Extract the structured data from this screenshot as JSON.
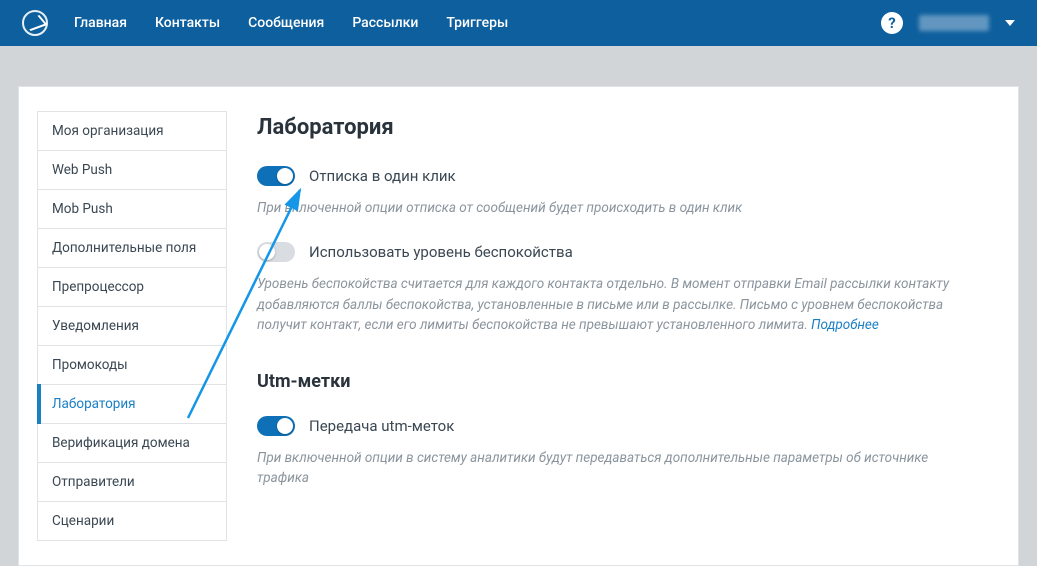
{
  "nav": {
    "items": [
      "Главная",
      "Контакты",
      "Сообщения",
      "Рассылки",
      "Триггеры"
    ]
  },
  "sidebar": {
    "items": [
      {
        "label": "Моя организация",
        "active": false
      },
      {
        "label": "Web Push",
        "active": false
      },
      {
        "label": "Mob Push",
        "active": false
      },
      {
        "label": "Дополнительные поля",
        "active": false
      },
      {
        "label": "Препроцессор",
        "active": false
      },
      {
        "label": "Уведомления",
        "active": false
      },
      {
        "label": "Промокоды",
        "active": false
      },
      {
        "label": "Лаборатория",
        "active": true
      },
      {
        "label": "Верификация домена",
        "active": false
      },
      {
        "label": "Отправители",
        "active": false
      },
      {
        "label": "Сценарии",
        "active": false
      }
    ]
  },
  "page": {
    "title": "Лаборатория",
    "option1": {
      "label": "Отписка в один клик",
      "desc": "При включенной опции отписка от сообщений будет происходить в один клик",
      "on": true
    },
    "option2": {
      "label": "Использовать уровень беспокойства",
      "desc": "Уровень беспокойства считается для каждого контакта отдельно. В момент отправки Email рассылки контакту добавляются баллы беспокойства, установленные в письме или в рассылке. Письмо с уровнем беспокойства получит контакт, если его лимиты беспокойства не превышают установленного лимита. ",
      "more": "Подробнее",
      "on": false
    },
    "section2_title": "Utm-метки",
    "option3": {
      "label": "Передача utm-меток",
      "desc": "При включенной опции в систему аналитики будут передаваться дополнительные параметры об источнике трафика",
      "on": true
    }
  }
}
